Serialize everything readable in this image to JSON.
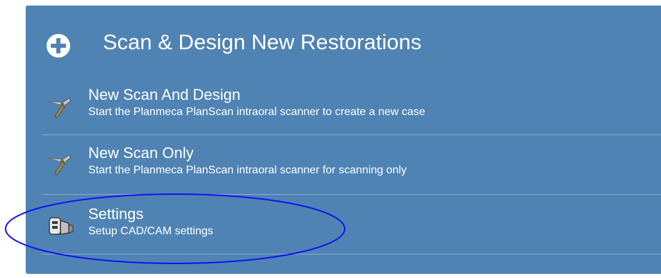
{
  "header": {
    "title": "Scan & Design New Restorations",
    "icon": "plus-circle-icon"
  },
  "items": [
    {
      "title": "New Scan And Design",
      "description": "Start the Planmeca PlanScan intraoral scanner to create a new case",
      "icon": "scanner-wand-icon"
    },
    {
      "title": "New Scan Only",
      "description": "Start the Planmeca PlanScan intraoral scanner for scanning only",
      "icon": "scanner-wand-icon"
    },
    {
      "title": "Settings",
      "description": "Setup CAD/CAM settings",
      "icon": "cad-cam-settings-icon"
    }
  ],
  "colors": {
    "panel": "#4f83b4",
    "text": "#ffffff",
    "annotation": "#1010ee"
  }
}
